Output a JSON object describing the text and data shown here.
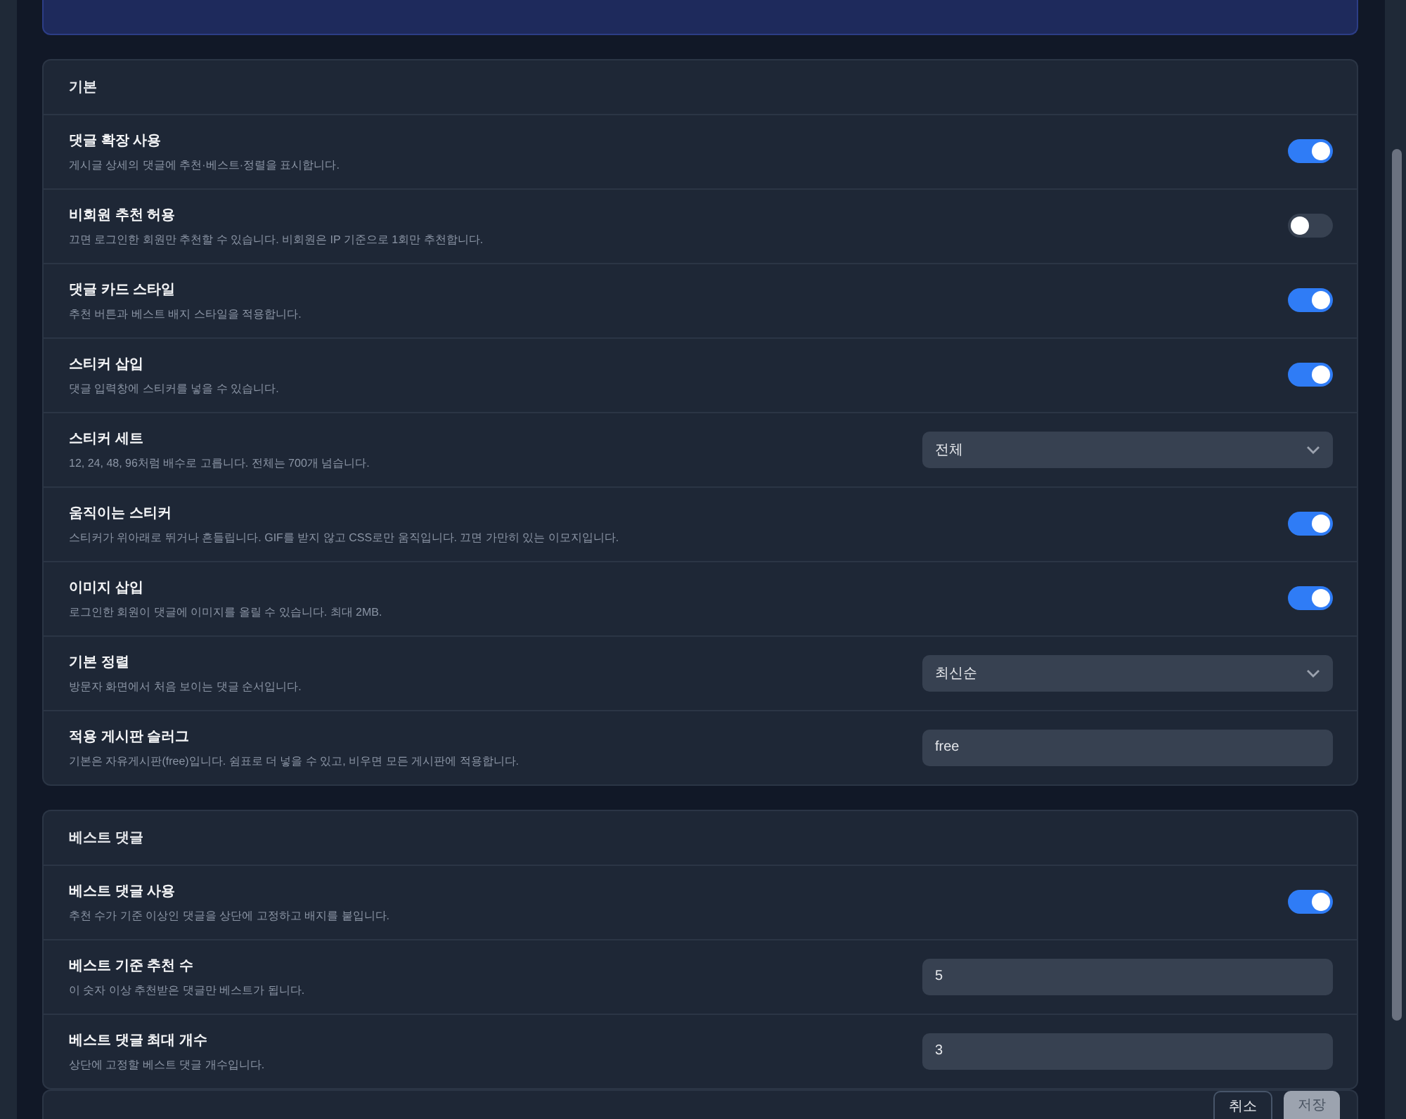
{
  "sections": [
    {
      "title": "기본",
      "rows": [
        {
          "kind": "toggle",
          "label": "댓글 확장 사용",
          "description": "게시글 상세의 댓글에 추천·베스트·정렬을 표시합니다.",
          "on": true
        },
        {
          "kind": "toggle",
          "label": "비회원 추천 허용",
          "description": "끄면 로그인한 회원만 추천할 수 있습니다. 비회원은 IP 기준으로 1회만 추천합니다.",
          "on": false
        },
        {
          "kind": "toggle",
          "label": "댓글 카드 스타일",
          "description": "추천 버튼과 베스트 배지 스타일을 적용합니다.",
          "on": true
        },
        {
          "kind": "toggle",
          "label": "스티커 삽입",
          "description": "댓글 입력창에 스티커를 넣을 수 있습니다.",
          "on": true
        },
        {
          "kind": "select",
          "label": "스티커 세트",
          "description": "12, 24, 48, 96처럼 배수로 고릅니다. 전체는 700개 넘습니다.",
          "value": "전체"
        },
        {
          "kind": "toggle",
          "label": "움직이는 스티커",
          "description": "스티커가 위아래로 뛰거나 흔들립니다. GIF를 받지 않고 CSS로만 움직입니다. 끄면 가만히 있는 이모지입니다.",
          "on": true
        },
        {
          "kind": "toggle",
          "label": "이미지 삽입",
          "description": "로그인한 회원이 댓글에 이미지를 올릴 수 있습니다. 최대 2MB.",
          "on": true
        },
        {
          "kind": "select",
          "label": "기본 정렬",
          "description": "방문자 화면에서 처음 보이는 댓글 순서입니다.",
          "value": "최신순"
        },
        {
          "kind": "input",
          "label": "적용 게시판 슬러그",
          "description": "기본은 자유게시판(free)입니다. 쉼표로 더 넣을 수 있고, 비우면 모든 게시판에 적용합니다.",
          "value": "free"
        }
      ]
    },
    {
      "title": "베스트 댓글",
      "rows": [
        {
          "kind": "toggle",
          "label": "베스트 댓글 사용",
          "description": "추천 수가 기준 이상인 댓글을 상단에 고정하고 배지를 붙입니다.",
          "on": true
        },
        {
          "kind": "input",
          "label": "베스트 기준 추천 수",
          "description": "이 숫자 이상 추천받은 댓글만 베스트가 됩니다.",
          "value": "5"
        },
        {
          "kind": "input",
          "label": "베스트 댓글 최대 개수",
          "description": "상단에 고정할 베스트 댓글 개수입니다.",
          "value": "3"
        }
      ]
    }
  ],
  "buttons": [
    {
      "label": "취소",
      "kind": "secondary",
      "disabled": false
    },
    {
      "label": "저장",
      "kind": "primary",
      "disabled": true
    }
  ]
}
